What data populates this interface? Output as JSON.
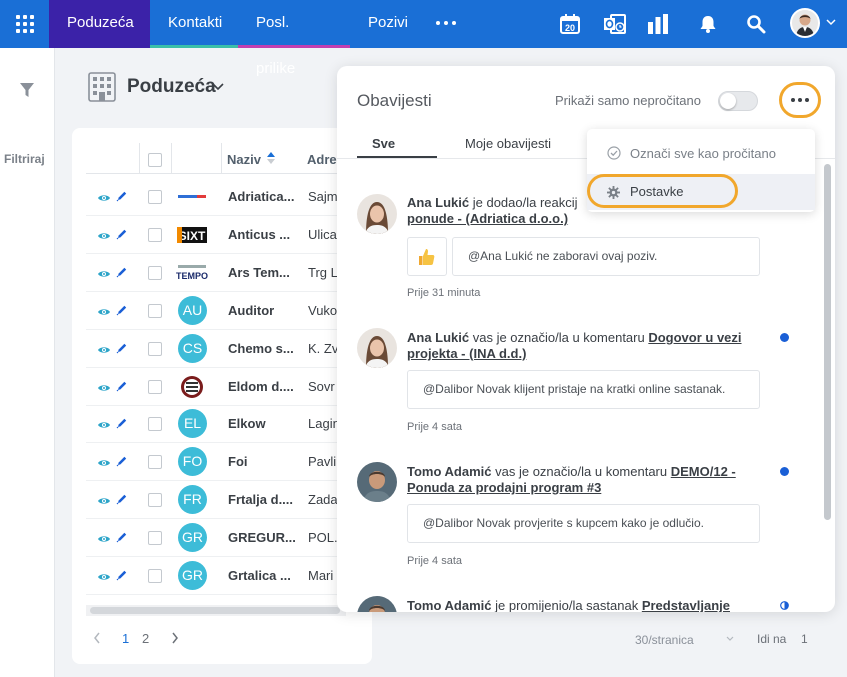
{
  "nav": {
    "tabs": [
      {
        "label": "Poduzeća",
        "active": true
      },
      {
        "label": "Kontakti",
        "accent": "#3bbfa8"
      },
      {
        "label": "Posl. prilike",
        "accent": "#c23fb0"
      },
      {
        "label": "Pozivi"
      }
    ],
    "calendar_day": "20",
    "icons": [
      "apps-grid-icon",
      "calendar-icon",
      "outlook-sync-icon",
      "reports-icon",
      "bell-icon",
      "search-icon",
      "user-avatar"
    ]
  },
  "sidebar": {
    "filter_label": "Filtriraj"
  },
  "page": {
    "title": "Poduzeća"
  },
  "table": {
    "col_naziv": "Naziv",
    "col_adresa": "Adre",
    "rows": [
      {
        "badge": "",
        "logo": "adriatica",
        "name": "Adriatica...",
        "addr": "Sajm"
      },
      {
        "badge": "",
        "logo": "sixt",
        "name": "Anticus ...",
        "addr": "Ulica"
      },
      {
        "badge": "",
        "logo": "tempo",
        "name": "Ars Tem...",
        "addr": "Trg L"
      },
      {
        "badge": "AU",
        "name": "Auditor",
        "addr": "Vuko"
      },
      {
        "badge": "CS",
        "name": "Chemo s...",
        "addr": "K. Zv"
      },
      {
        "badge": "",
        "logo": "eldom",
        "name": "Eldom d....",
        "addr": "Sovr"
      },
      {
        "badge": "EL",
        "name": "Elkow",
        "addr": "Lagin"
      },
      {
        "badge": "FO",
        "name": "Foi",
        "addr": "Pavli"
      },
      {
        "badge": "FR",
        "name": "Frtalja d....",
        "addr": "Zada"
      },
      {
        "badge": "GR",
        "name": "GREGUR...",
        "addr": "POL."
      },
      {
        "badge": "GR",
        "name": "Grtalica ...",
        "addr": "Mari"
      }
    ]
  },
  "pager": {
    "page1": "1",
    "page2": "2",
    "per_page": "30/stranica",
    "goto_label": "Idi na",
    "goto_value": "1"
  },
  "notifications": {
    "title": "Obavijesti",
    "unread_only_label": "Prikaži samo nepročitano",
    "tabs": [
      "Sve",
      "Moje obavijesti"
    ],
    "items": [
      {
        "author": "Ana Lukić",
        "action": " je dodao/la reakcij",
        "link": "ponude - (Adriatica d.o.o.)",
        "comment": "@Ana Lukić ne zaboravi ovaj poziv.",
        "time": "Prije 31 minuta"
      },
      {
        "author": "Ana Lukić",
        "action": " vas je označio/la u komentaru ",
        "link": "Dogovor u vezi projekta - (INA d.d.)",
        "comment": "@Dalibor Novak klijent pristaje na kratki online sastanak.",
        "time": "Prije 4 sata"
      },
      {
        "author": "Tomo Adamić",
        "action": " vas je označio/la u komentaru ",
        "link": "DEMO/12 - Ponuda za prodajni program #3",
        "comment": "@Dalibor Novak provjerite s kupcem kako je odlučio.",
        "time": "Prije 4 sata"
      },
      {
        "author": "Tomo Adamić",
        "action": " je promijenio/la sastanak ",
        "link": "Predstavljanje"
      }
    ]
  },
  "menu": {
    "mark_all_read": "Označi sve kao pročitano",
    "settings": "Postavke"
  },
  "colors": {
    "nav_bg": "#1a6fd6",
    "active_tab": "#3b22a8",
    "highlight": "#f1a72c",
    "badge": "#3dbcd8",
    "unread_dot": "#1a5fd6"
  }
}
